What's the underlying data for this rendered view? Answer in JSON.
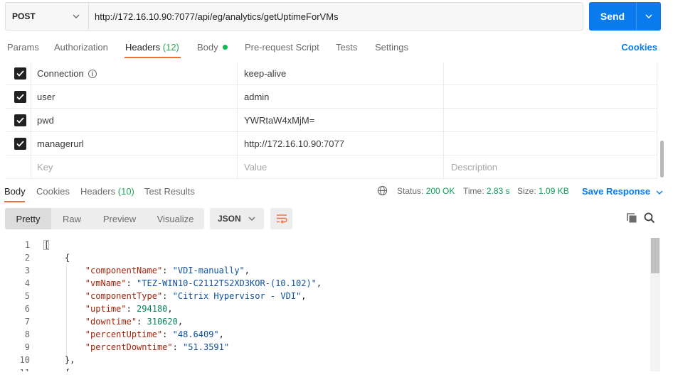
{
  "request": {
    "method": "POST",
    "url": "http://172.16.10.90:7077/api/eg/analytics/getUptimeForVMs",
    "send_label": "Send"
  },
  "request_tabs": {
    "params": "Params",
    "authorization": "Authorization",
    "headers": "Headers",
    "headers_count": "(12)",
    "body": "Body",
    "prerequest": "Pre-request Script",
    "tests": "Tests",
    "settings": "Settings",
    "cookies": "Cookies"
  },
  "headers_table": {
    "rows": [
      {
        "key": "Connection",
        "value": "keep-alive",
        "checked": true,
        "info": true
      },
      {
        "key": "user",
        "value": "admin",
        "checked": true
      },
      {
        "key": "pwd",
        "value": "YWRtaW4xMjM=",
        "checked": true
      },
      {
        "key": "managerurl",
        "value": "http://172.16.10.90:7077",
        "checked": true
      }
    ],
    "placeholder": {
      "key": "Key",
      "value": "Value",
      "description": "Description"
    }
  },
  "response_tabs": {
    "body": "Body",
    "cookies": "Cookies",
    "headers": "Headers",
    "headers_count": "(10)",
    "test_results": "Test Results"
  },
  "status": {
    "status_label": "Status:",
    "status_value": "200 OK",
    "time_label": "Time:",
    "time_value": "2.83 s",
    "size_label": "Size:",
    "size_value": "1.09 KB",
    "save_response": "Save Response"
  },
  "view": {
    "pretty": "Pretty",
    "raw": "Raw",
    "preview": "Preview",
    "visualize": "Visualize",
    "format": "JSON"
  },
  "code_lines": [
    {
      "n": "1",
      "t": "["
    },
    {
      "n": "2",
      "t": "    {"
    },
    {
      "n": "3",
      "k": "\"componentName\"",
      "v": "\"VDI-manually\"",
      "vt": "s",
      "end": ","
    },
    {
      "n": "4",
      "k": "\"vmName\"",
      "v": "\"TEZ-WIN10-C2112TS2XD3KOR-(10.102)\"",
      "vt": "s",
      "end": ","
    },
    {
      "n": "5",
      "k": "\"componentType\"",
      "v": "\"Citrix Hypervisor - VDI\"",
      "vt": "s",
      "end": ","
    },
    {
      "n": "6",
      "k": "\"uptime\"",
      "v": "294180",
      "vt": "n",
      "end": ","
    },
    {
      "n": "7",
      "k": "\"downtime\"",
      "v": "310620",
      "vt": "n",
      "end": ","
    },
    {
      "n": "8",
      "k": "\"percentUptime\"",
      "v": "\"48.6409\"",
      "vt": "s",
      "end": ","
    },
    {
      "n": "9",
      "k": "\"percentDowntime\"",
      "v": "\"51.3591\"",
      "vt": "s",
      "end": ""
    },
    {
      "n": "10",
      "t": "    },"
    },
    {
      "n": "11",
      "t": "    {"
    }
  ],
  "colors": {
    "accent": "#097bed",
    "tab_underline": "#f26b3a",
    "status_ok": "#0f9d58",
    "json_key": "#a1260d",
    "json_string": "#0d4f9e",
    "json_number": "#098658"
  },
  "icons": {
    "method_dropdown": "chevron-down-icon",
    "send_dropdown": "chevron-down-icon",
    "info": "info-icon",
    "globe": "globe-icon",
    "wrap": "wrap-lines-icon",
    "copy": "copy-icon",
    "search": "search-icon"
  }
}
